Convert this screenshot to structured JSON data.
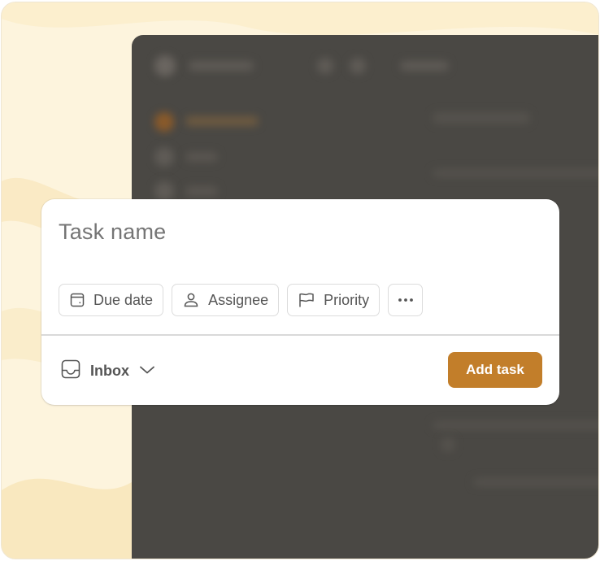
{
  "composer": {
    "task_name_placeholder": "Task name",
    "chips": {
      "due_date": "Due date",
      "assignee": "Assignee",
      "priority": "Priority",
      "more_icon": "ellipsis-icon"
    },
    "project": {
      "label": "Inbox",
      "icon": "inbox-icon",
      "dropdown_icon": "chevron-down-icon"
    },
    "submit_label": "Add task"
  },
  "colors": {
    "accent": "#c27e2a",
    "backdrop": "#fdf4dd",
    "app_background": "#4a4844"
  }
}
